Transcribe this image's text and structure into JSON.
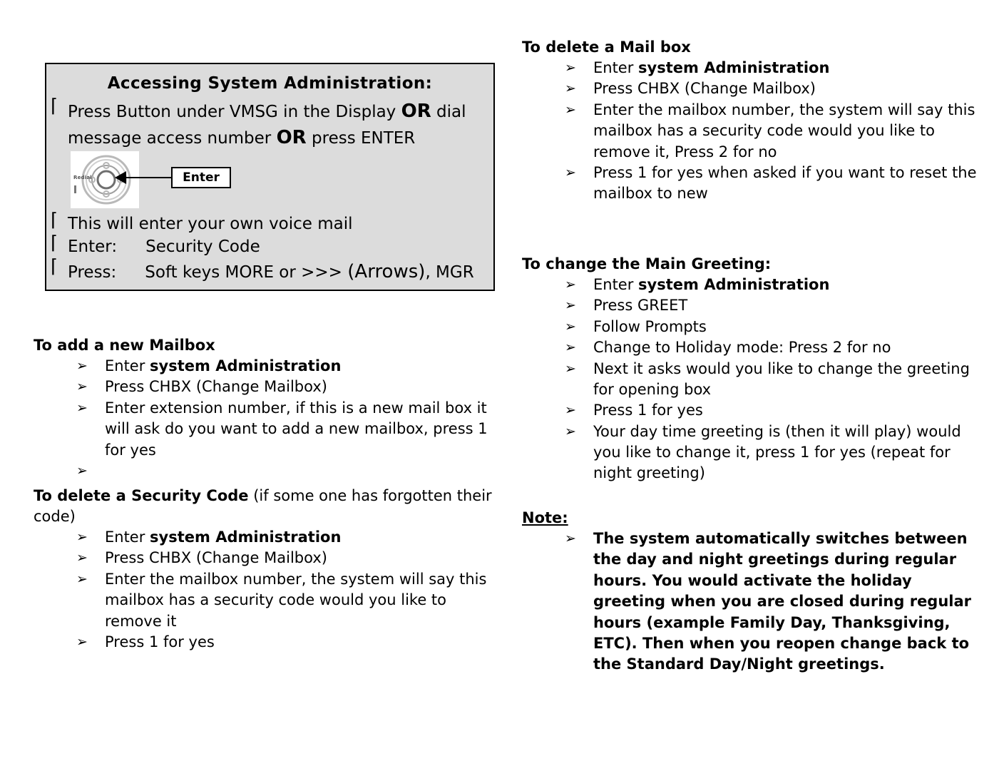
{
  "document": {
    "bullet_arrow_glyph": "➢",
    "bullet_corner_glyph": "⌈",
    "box_fill_color": "#dcdcdc",
    "box_border_color": "#000000",
    "text_color": "#000000",
    "page_background": "#ffffff"
  },
  "gray_box": {
    "title": "Accessing System Administration:",
    "line1_pre": "Press Button under VMSG in the Display ",
    "line1_or": "OR",
    "line1_post": " dial",
    "line2_pre": "message access number ",
    "line2_or": "OR",
    "line2_post": " press ENTER",
    "phone": {
      "redial_label": "Redial",
      "callout_label": "Enter",
      "icon": "navigation-disk"
    },
    "item_voicemail": "This will enter your own voice mail",
    "item_enter_label": "Enter:",
    "item_enter_value": "Security Code",
    "item_press_label": "Press:",
    "item_press_value_a": "Soft keys  MORE or >>> ",
    "item_press_value_b": "(Arrows)",
    "item_press_value_c": ",   MGR"
  },
  "left_column": {
    "sections": [
      {
        "heading_bold": "To add a new Mailbox",
        "heading_normal": "",
        "items": [
          {
            "pre": "Enter ",
            "bold": "system Administration",
            "post": ""
          },
          {
            "pre": "Press CHBX (Change Mailbox)",
            "bold": "",
            "post": ""
          },
          {
            "pre": "Enter extension number, if this is a new mail box it will ask do you want to add a new mailbox, press 1 for yes",
            "bold": "",
            "post": ""
          },
          {
            "pre": "",
            "bold": "",
            "post": ""
          }
        ]
      },
      {
        "heading_bold": "To delete a Security Code",
        "heading_normal": " (if some one has forgotten their code)",
        "items": [
          {
            "pre": "Enter ",
            "bold": "system Administration",
            "post": ""
          },
          {
            "pre": "Press CHBX (Change Mailbox)",
            "bold": "",
            "post": ""
          },
          {
            "pre": "Enter the mailbox number, the system will say this mailbox has a security code would you like to remove it",
            "bold": "",
            "post": ""
          },
          {
            "pre": "Press 1 for yes",
            "bold": "",
            "post": ""
          }
        ]
      }
    ]
  },
  "right_column": {
    "sections": [
      {
        "heading_bold": "To delete a Mail box",
        "heading_normal": "",
        "items": [
          {
            "pre": "Enter ",
            "bold": "system Administration",
            "post": ""
          },
          {
            "pre": "Press CHBX (Change Mailbox)",
            "bold": "",
            "post": ""
          },
          {
            "pre": "Enter the mailbox number, the system will say this mailbox has a security code would you like to remove it, Press 2 for no",
            "bold": "",
            "post": ""
          },
          {
            "pre": "Press 1 for yes when asked if you want to reset the mailbox to new",
            "bold": "",
            "post": ""
          }
        ]
      },
      {
        "heading_bold": "To change the Main Greeting:",
        "heading_normal": "",
        "items": [
          {
            "pre": "Enter ",
            "bold": "system Administration",
            "post": ""
          },
          {
            "pre": "Press GREET",
            "bold": "",
            "post": ""
          },
          {
            "pre": "Follow Prompts",
            "bold": "",
            "post": ""
          },
          {
            "pre": "Change to Holiday mode:  Press 2 for no",
            "bold": "",
            "post": ""
          },
          {
            "pre": "Next it asks would you like to change the greeting for opening box",
            "bold": "",
            "post": ""
          },
          {
            "pre": "Press 1 for yes",
            "bold": "",
            "post": ""
          },
          {
            "pre": "Your day time greeting is (then it will play) would you like to change it, press 1 for yes  (repeat for night greeting)",
            "bold": "",
            "post": ""
          }
        ]
      }
    ],
    "note": {
      "heading": "Note:",
      "items": [
        "The system automatically switches between the day and night greetings during regular hours.     You would activate the holiday greeting when you are closed during regular hours (example Family Day, Thanksgiving, ETC).    Then when you reopen change back to the Standard Day/Night greetings."
      ]
    }
  }
}
